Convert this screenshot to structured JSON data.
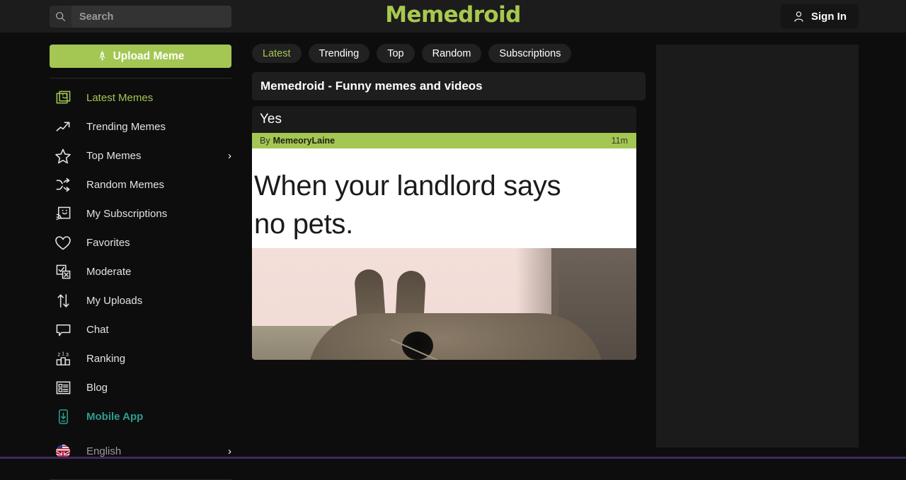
{
  "brand": {
    "logo_text": "Memedroid",
    "logo_color": "#a8c94f",
    "accent_green": "#a4c653",
    "accent_teal": "#2f9e8f",
    "background": "#0d0d0d",
    "header_background": "#1c1c1c"
  },
  "header": {
    "search_placeholder": "Search",
    "search_value": "",
    "search_icon": "search-icon",
    "signin_label": "Sign In",
    "signin_icon": "user-icon"
  },
  "sidebar": {
    "upload_label": "Upload Meme",
    "upload_icon": "rocket-icon",
    "items": [
      {
        "label": "Latest Memes",
        "icon": "smiley-square-icon",
        "style": "green",
        "chevron": ""
      },
      {
        "label": "Trending Memes",
        "icon": "trend-arrow-icon",
        "style": "normal",
        "chevron": ""
      },
      {
        "label": "Top Memes",
        "icon": "star-icon",
        "style": "normal",
        "chevron": "›"
      },
      {
        "label": "Random Memes",
        "icon": "shuffle-icon",
        "style": "normal",
        "chevron": ""
      },
      {
        "label": "My Subscriptions",
        "icon": "rss-smiley-icon",
        "style": "normal",
        "chevron": ""
      },
      {
        "label": "Favorites",
        "icon": "heart-icon",
        "style": "normal",
        "chevron": ""
      },
      {
        "label": "Moderate",
        "icon": "checkbox-x-icon",
        "style": "normal",
        "chevron": ""
      },
      {
        "label": "My Uploads",
        "icon": "up-down-arrows-icon",
        "style": "normal",
        "chevron": ""
      },
      {
        "label": "Chat",
        "icon": "speech-bubble-icon",
        "style": "normal",
        "chevron": ""
      },
      {
        "label": "Ranking",
        "icon": "podium-icon",
        "style": "normal",
        "chevron": ""
      },
      {
        "label": "Blog",
        "icon": "list-card-icon",
        "style": "normal",
        "chevron": ""
      },
      {
        "label": "Mobile App",
        "icon": "phone-download-icon",
        "style": "teal",
        "chevron": ""
      }
    ],
    "language": {
      "label": "English",
      "icon": "uk-us-flag-icon",
      "chevron": "›"
    }
  },
  "main": {
    "tabs": [
      {
        "label": "Latest",
        "active": true
      },
      {
        "label": "Trending",
        "active": false
      },
      {
        "label": "Top",
        "active": false
      },
      {
        "label": "Random",
        "active": false
      },
      {
        "label": "Subscriptions",
        "active": false
      }
    ],
    "page_title": "Memedroid - Funny memes and videos",
    "post": {
      "title": "Yes",
      "by_prefix": "By",
      "author": "MemeoryLaine",
      "time": "11m",
      "caption": "When your landlord says\nno pets.",
      "image_alt": "rabbit-with-ty-tag-photo"
    }
  },
  "ad": {
    "placeholder": ""
  }
}
